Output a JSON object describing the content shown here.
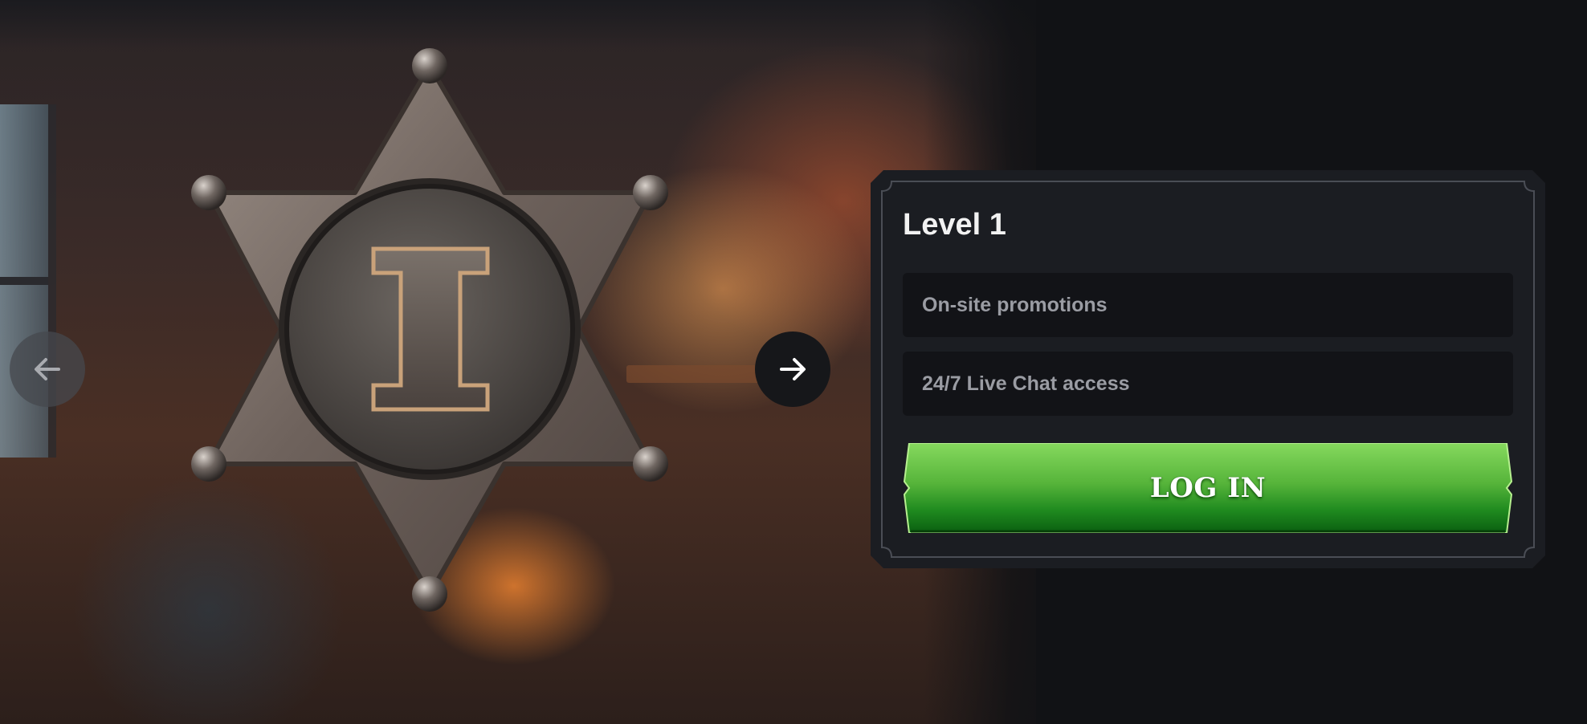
{
  "carousel": {
    "badge_numeral": "I",
    "prev_icon": "arrow-left-icon",
    "next_icon": "arrow-right-icon"
  },
  "level_panel": {
    "title": "Level 1",
    "perks": [
      "On-site promotions",
      "24/7 Live Chat access"
    ],
    "login_label": "LOG IN"
  },
  "colors": {
    "panel_bg": "#1b1d22",
    "perk_bg": "#121317",
    "button_green_top": "#7dd35a",
    "button_green_bottom": "#0b6a12",
    "page_bg": "#111215"
  }
}
